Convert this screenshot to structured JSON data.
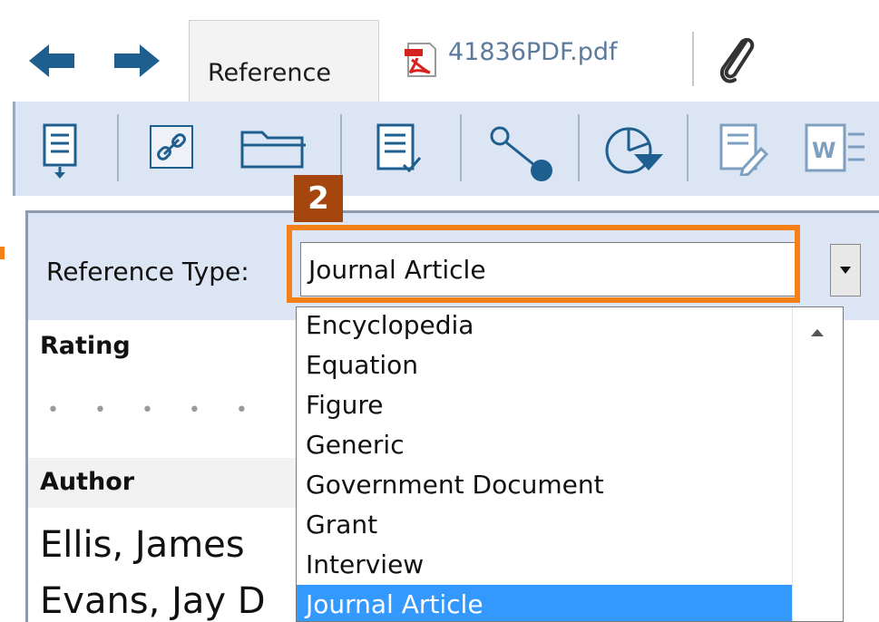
{
  "tabs": {
    "reference_label": "Reference",
    "pdf_label": "41836PDF.pdf"
  },
  "toolbar": {
    "icons": [
      "insert-citation-icon",
      "link-icon",
      "folder-icon",
      "format-bibliography-icon",
      "share-icon",
      "chart-icon",
      "edit-icon",
      "word-icon"
    ]
  },
  "callout": "2",
  "reference_type": {
    "label": "Reference Type:",
    "value": "Journal Article"
  },
  "fields": {
    "rating_label": "Rating",
    "rating_stars": "• • • • •",
    "author_label": "Author",
    "authors": [
      "Ellis, James",
      "Evans, Jay D"
    ]
  },
  "dropdown": {
    "options": [
      "Encyclopedia",
      "Equation",
      "Figure",
      "Generic",
      "Government Document",
      "Grant",
      "Interview",
      "Journal Article"
    ],
    "selected_index": 7
  },
  "colors": {
    "accent_orange": "#f57f17",
    "callout_brown": "#a5460f",
    "selection_blue": "#3399ff",
    "toolbar_bg": "#dce5f3",
    "arrow_blue": "#1f5f8f"
  }
}
